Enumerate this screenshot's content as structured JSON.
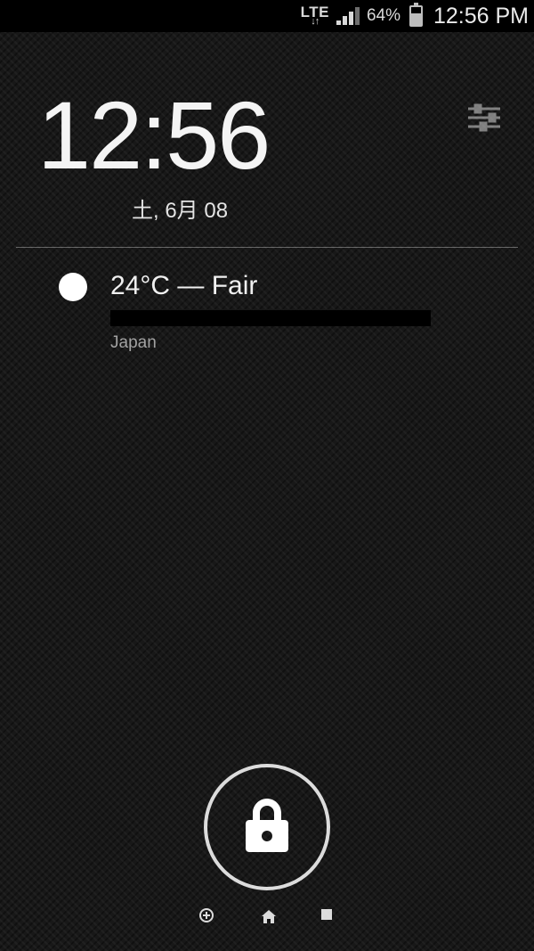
{
  "statusbar": {
    "network_label": "LTE",
    "battery_percent": "64%",
    "clock": "12:56 PM"
  },
  "clock_widget": {
    "time": "12:56",
    "date": "土, 6月 08"
  },
  "weather": {
    "summary": "24°C — Fair",
    "location": "Japan"
  },
  "icons": {
    "sliders": "sliders-icon",
    "lock": "lock-icon",
    "add": "add-icon",
    "home": "home-icon",
    "square": "square-icon"
  }
}
